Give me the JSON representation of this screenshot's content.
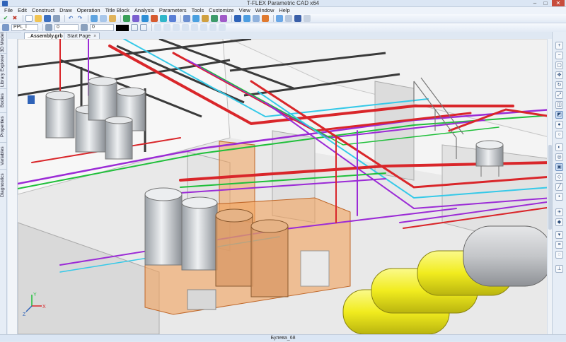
{
  "window": {
    "title": "T-FLEX Parametric CAD x64",
    "minimize": "–",
    "maximize": "□",
    "close": "✕"
  },
  "menu": [
    "File",
    "Edit",
    "Construct",
    "Draw",
    "Operation",
    "Title Block",
    "Analysis",
    "Parameters",
    "Tools",
    "Customize",
    "View",
    "Window",
    "Help"
  ],
  "toolbar2": {
    "page_field": "PPL_l",
    "layer_value": "0",
    "level_value": "0"
  },
  "tabs": [
    {
      "label": "_Assembly.grb",
      "active": true,
      "close": "×"
    },
    {
      "label": "Start Page",
      "active": false,
      "close": "×"
    }
  ],
  "left_dock": [
    "3D Model",
    "Library Explorer",
    "Bodies",
    "Properties",
    "Variables",
    "Diagnostics"
  ],
  "axis": {
    "x": "X",
    "y": "Y",
    "z": "Z"
  },
  "status": {
    "text": "Булева_68"
  },
  "colors": {
    "accent": "#2f63b8",
    "pipe_red": "#d9262a",
    "pipe_purple": "#9b2bd6",
    "pipe_green": "#1fbf3a",
    "pipe_cyan": "#35c9e8",
    "tank_yellow": "#f4f02a",
    "orange_zone": "#f2a25b"
  }
}
